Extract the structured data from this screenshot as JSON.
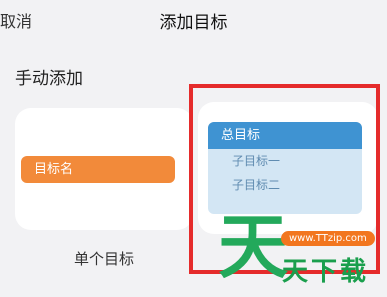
{
  "header": {
    "cancel_label": "取消",
    "title": "添加目标"
  },
  "section": {
    "manual_add_label": "手动添加"
  },
  "templates": {
    "single": {
      "goal_name": "目标名",
      "caption": "单个目标"
    },
    "total": {
      "head": "总目标",
      "sub1": "子目标一",
      "sub2": "子目标二"
    }
  },
  "watermark": {
    "logo_char": "天",
    "url": "www.TTzip.com",
    "text": "天下载"
  },
  "colors": {
    "orange": "#f28a3a",
    "blue": "#3f93d2",
    "light_blue": "#d3e6f4",
    "highlight": "#e52b2b"
  }
}
